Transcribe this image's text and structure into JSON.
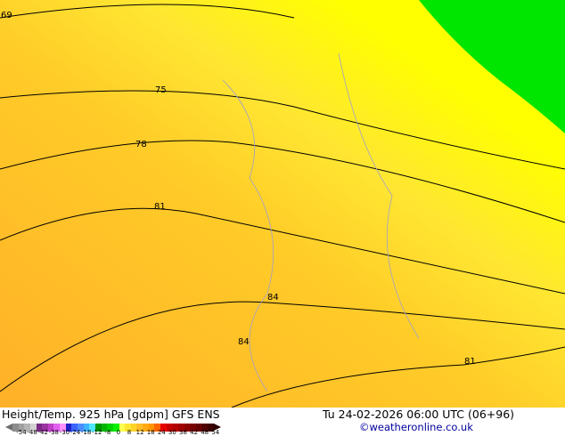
{
  "footer": {
    "title": "Height/Temp. 925 hPa [gdpm] GFS ENS",
    "datetime": "Tu 24-02-2026 06:00 UTC (06+96)",
    "credit": "©weatheronline.co.uk"
  },
  "colorbar": {
    "ticks": [
      "-54",
      "-48",
      "-42",
      "-38",
      "-30",
      "-24",
      "-18",
      "-12",
      "-8",
      "0",
      "8",
      "12",
      "18",
      "24",
      "30",
      "38",
      "42",
      "48",
      "54"
    ],
    "colors": [
      "#8c8c8c",
      "#a0a0a0",
      "#b4b4b4",
      "#d2d2d2",
      "#7a2a82",
      "#9a32a0",
      "#c040c8",
      "#e060f0",
      "#ff90ff",
      "#2020c8",
      "#3c64ff",
      "#4c8cff",
      "#3cb4ff",
      "#50e6ff",
      "#009600",
      "#00b400",
      "#00d200",
      "#00f000",
      "#ffff50",
      "#ffe632",
      "#ffd228",
      "#ffbe28",
      "#ffaa14",
      "#ff9600",
      "#ff6400",
      "#e60000",
      "#c80000",
      "#b40000",
      "#a00000",
      "#8c0000",
      "#780000",
      "#640000",
      "#500000",
      "#3c0000"
    ]
  },
  "map": {
    "contour_labels": [
      "69",
      "75",
      "78",
      "81",
      "84",
      "84",
      "81"
    ],
    "colors": {
      "orange": "#ffb428",
      "yellow": "#ffff00",
      "green": "#00e600"
    }
  }
}
